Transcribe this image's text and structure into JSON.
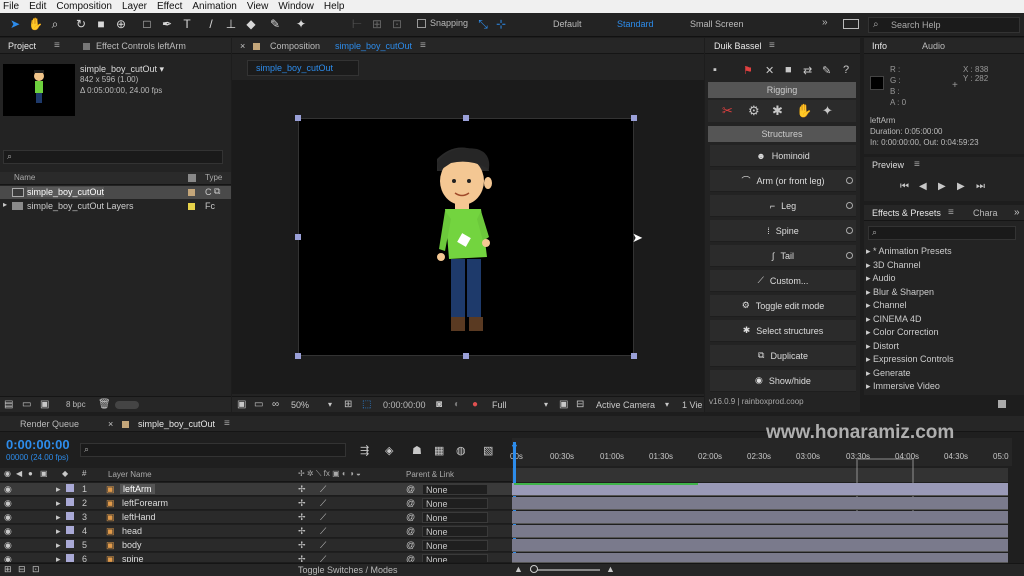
{
  "menu": [
    "File",
    "Edit",
    "Composition",
    "Layer",
    "Effect",
    "Animation",
    "View",
    "Window",
    "Help"
  ],
  "toolbar": {
    "snapping": "Snapping",
    "workspaces": [
      "Default",
      "Standard",
      "Small Screen"
    ],
    "active_workspace": "Standard",
    "search_placeholder": "Search Help"
  },
  "project": {
    "tabs": [
      "Project",
      "Effect Controls leftArm"
    ],
    "comp_name": "simple_boy_cutOut ▾",
    "comp_size": "842 x 596 (1.00)",
    "comp_duration": "Δ 0:05:00:00, 24.00 fps",
    "columns": {
      "name": "Name",
      "type": "Type"
    },
    "items": [
      {
        "name": "simple_boy_cutOut",
        "type": "C"
      },
      {
        "name": "simple_boy_cutOut Layers",
        "type": "Fc"
      }
    ],
    "bpc": "8 bpc"
  },
  "composition": {
    "tab_prefix": "Composition ",
    "tab_name": "simple_boy_cutOut",
    "subtab": "simple_boy_cutOut",
    "zoom": "50%",
    "timecode": "0:00:00:00",
    "resolution": "Full",
    "camera": "Active Camera",
    "view": "1 Vie"
  },
  "duik": {
    "title": "Duik Bassel",
    "rigging": "Rigging",
    "structures": "Structures",
    "buttons": [
      "Hominoid",
      "Arm (or front leg)",
      "Leg",
      "Spine",
      "Tail",
      "Custom...",
      "Toggle edit mode",
      "Select structures",
      "Duplicate",
      "Show/hide"
    ],
    "version": "v16.0.9 | rainboxprod.coop"
  },
  "info": {
    "tabs": [
      "Info",
      "Audio"
    ],
    "r": "R :",
    "g": "G :",
    "b": "B :",
    "a": "A : 0",
    "x": "X : 838",
    "y": "Y : 282",
    "layer": "leftArm",
    "duration": "Duration: 0:05:00:00",
    "inout": "In: 0:00:00:00, Out: 0:04:59:23"
  },
  "preview": {
    "title": "Preview"
  },
  "effects": {
    "tabs": [
      "Effects & Presets",
      "Chara"
    ],
    "items": [
      "* Animation Presets",
      "3D Channel",
      "Audio",
      "Blur & Sharpen",
      "Channel",
      "CINEMA 4D",
      "Color Correction",
      "Distort",
      "Expression Controls",
      "Generate",
      "Immersive Video"
    ]
  },
  "timeline": {
    "tabs": [
      "Render Queue",
      "simple_boy_cutOut"
    ],
    "timecode": "0:00:00:00",
    "frames": "00000 (24.00 fps)",
    "col_layer": "Layer Name",
    "col_parent": "Parent & Link",
    "ruler": [
      "00s",
      "00:30s",
      "01:00s",
      "01:30s",
      "02:00s",
      "02:30s",
      "03:00s",
      "03:30s",
      "04:00s",
      "04:30s",
      "05:0"
    ],
    "layers": [
      {
        "num": "1",
        "name": "leftArm",
        "parent": "None"
      },
      {
        "num": "2",
        "name": "leftForearm",
        "parent": "None"
      },
      {
        "num": "3",
        "name": "leftHand",
        "parent": "None"
      },
      {
        "num": "4",
        "name": "head",
        "parent": "None"
      },
      {
        "num": "5",
        "name": "body",
        "parent": "None"
      },
      {
        "num": "6",
        "name": "spine",
        "parent": "None"
      }
    ],
    "toggle_label": "Toggle Switches / Modes"
  },
  "watermark": "www.honaramiz.com"
}
